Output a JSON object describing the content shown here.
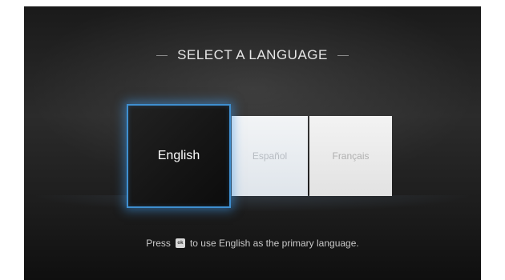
{
  "title": "SELECT A LANGUAGE",
  "languages": [
    {
      "label": "English",
      "selected": true
    },
    {
      "label": "Español",
      "selected": false
    },
    {
      "label": "Français",
      "selected": false
    }
  ],
  "hint": {
    "before": "Press",
    "key_icon": "ok-key-icon",
    "key_glyph": "ok",
    "after": "to use English as the primary language."
  },
  "colors": {
    "selection_glow": "#3f8fd0",
    "background": "#1f1f1f"
  }
}
